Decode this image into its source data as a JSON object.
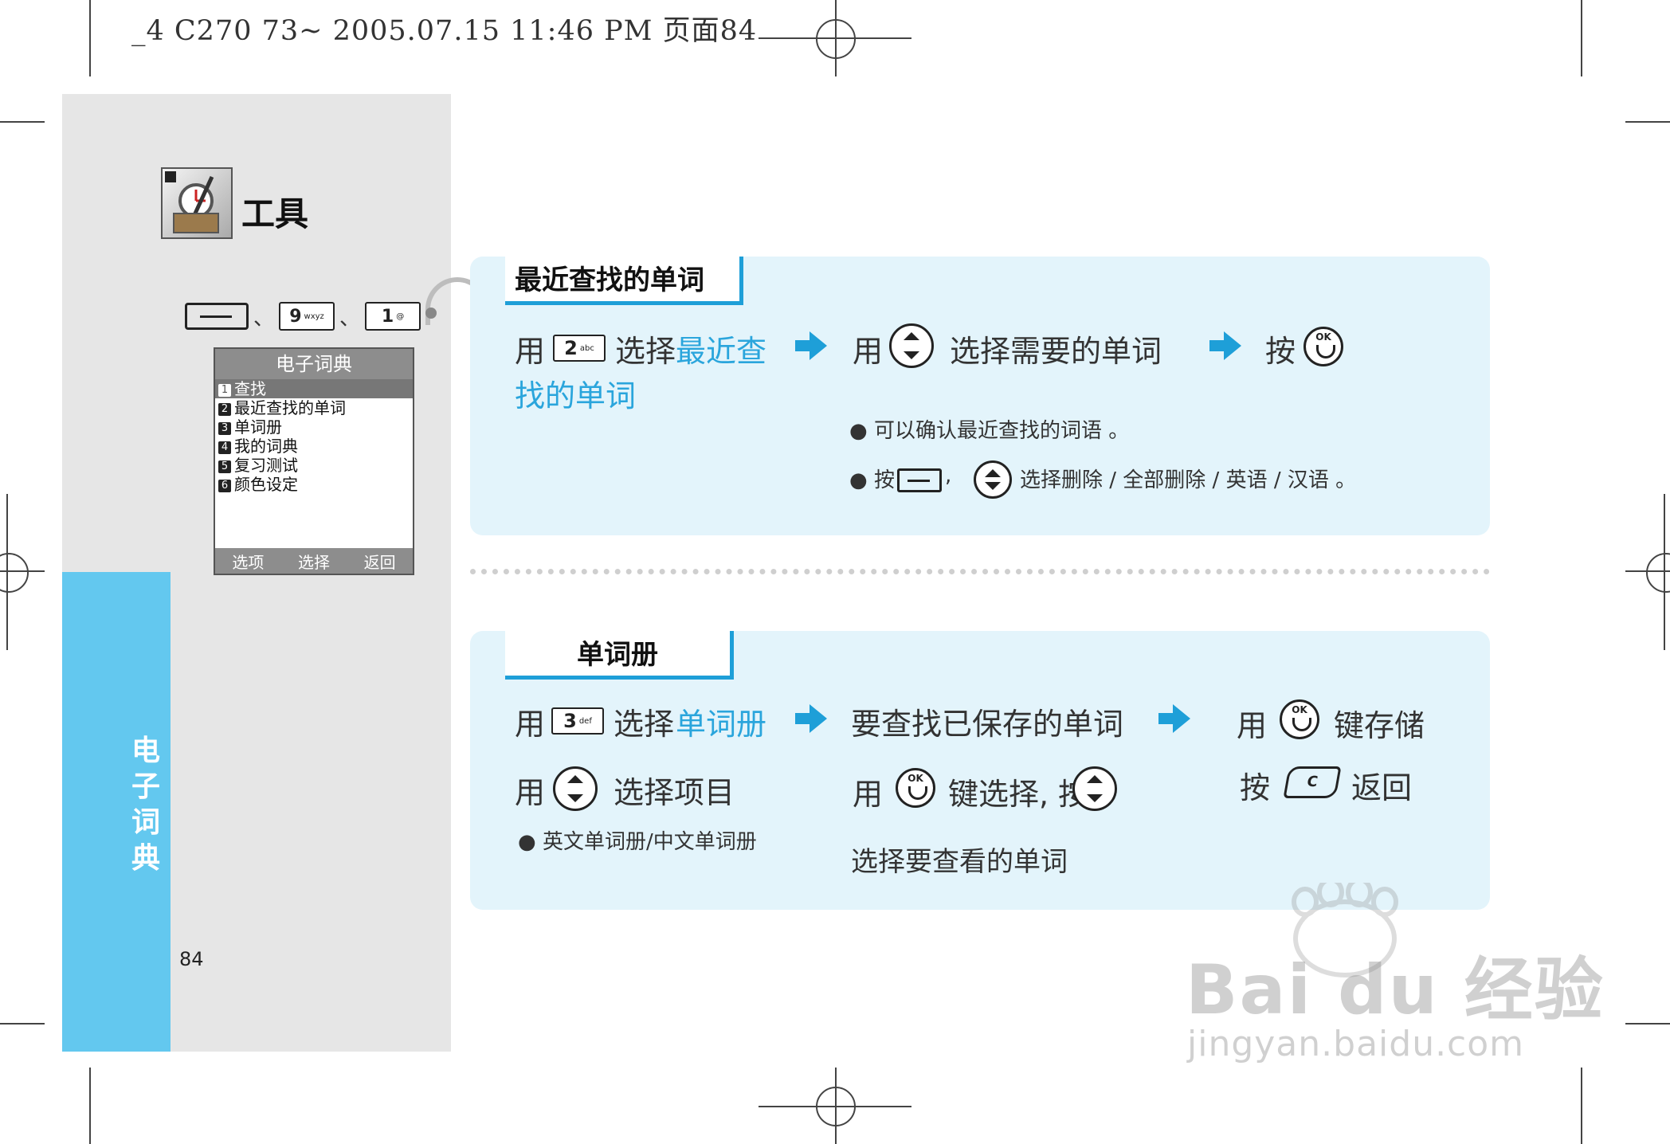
{
  "print_header": "_4 C270 73~ 2005.07.15 11:46 PM 页面84",
  "sidebar": {
    "title": "工具",
    "vertical_label": "电子词典",
    "page_number": "84",
    "keys": [
      "9",
      "wxyz",
      "1",
      "@"
    ],
    "comma": "、"
  },
  "phone": {
    "title": "电子词典",
    "items": [
      {
        "n": "1",
        "label": "查找"
      },
      {
        "n": "2",
        "label": "最近查找的单词"
      },
      {
        "n": "3",
        "label": "单词册"
      },
      {
        "n": "4",
        "label": "我的词典"
      },
      {
        "n": "5",
        "label": "复习测试"
      },
      {
        "n": "6",
        "label": "颜色设定"
      }
    ],
    "softkeys": [
      "选项",
      "选择",
      "返回"
    ]
  },
  "section1": {
    "tab": "最近查找的单词",
    "use": "用",
    "key2": "2",
    "key2_sub": "abc",
    "select": "选择",
    "hl_1": "最近查",
    "hl_2": "找的单词",
    "step2": "选择需要的单词",
    "press": "按",
    "note1": "可以确认最近查找的词语 。",
    "note2_press": "按",
    "note2_comma": ",",
    "note2_text": "选择删除 / 全部删除 / 英语 / 汉语 。"
  },
  "section2": {
    "tab": "单词册",
    "use": "用",
    "key3": "3",
    "key3_sub": "def",
    "select": "选择",
    "hl": "单词册",
    "step2": "要查找已保存的单词",
    "save_key": "键存储",
    "select_item": "选择项目",
    "note1": "英文单词册/中文单词册",
    "key_select": "键选择, 按",
    "select_view": "选择要查看的单词",
    "press": "按",
    "back": "返回",
    "c_label": "C"
  },
  "ok_label": "OK",
  "watermark": {
    "brand": "Bai du 经验",
    "url": "jingyan.baidu.com"
  }
}
